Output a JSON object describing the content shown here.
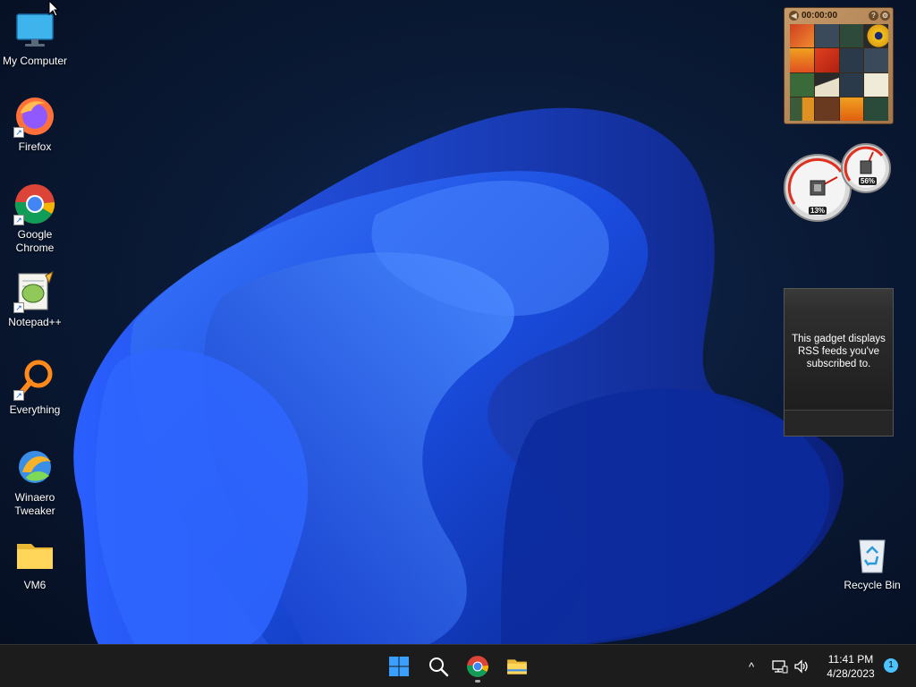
{
  "desktop": {
    "icons": [
      {
        "label": "My Computer",
        "icon": "monitor-icon"
      },
      {
        "label": "Firefox",
        "icon": "firefox-icon"
      },
      {
        "label": "Google Chrome",
        "icon": "chrome-icon"
      },
      {
        "label": "Notepad++",
        "icon": "notepadpp-icon"
      },
      {
        "label": "Everything",
        "icon": "search-magnifier-icon"
      },
      {
        "label": "Winaero Tweaker",
        "icon": "winaero-icon"
      },
      {
        "label": "VM6",
        "icon": "folder-icon"
      },
      {
        "label": "Recycle Bin",
        "icon": "recycle-bin-icon"
      }
    ]
  },
  "gadgets": {
    "puzzle": {
      "timer": "00:00:00",
      "help": "?",
      "menu": "⚙",
      "back": "◀"
    },
    "cpu_meter": {
      "cpu_percent": "13%",
      "memory_percent": "56%"
    },
    "rss": {
      "message": "This gadget displays RSS feeds you've subscribed to."
    }
  },
  "taskbar": {
    "buttons": [
      "start-icon",
      "search-icon",
      "chrome-icon",
      "file-explorer-icon"
    ],
    "tray": {
      "chevron": "^",
      "time": "11:41 PM",
      "date": "4/28/2023",
      "notifications": "1"
    }
  },
  "colors": {
    "accent": "#1e6fff",
    "taskbar": "#1c1c1c",
    "notification": "#4cc2ff"
  }
}
